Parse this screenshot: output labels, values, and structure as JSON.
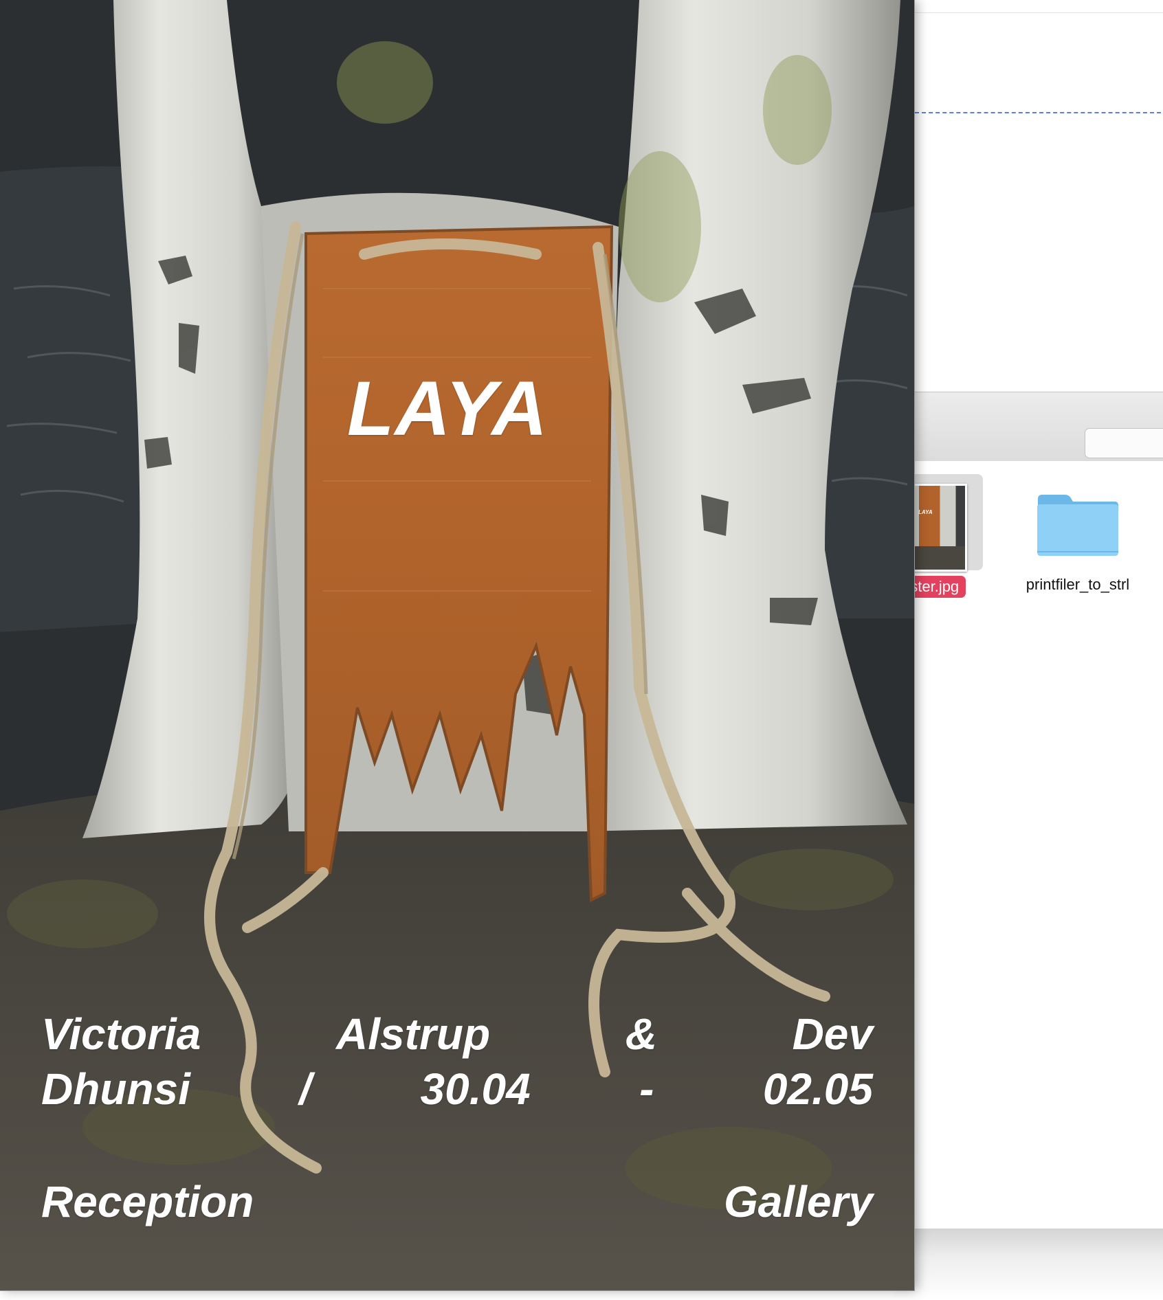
{
  "poster": {
    "title": "LAYA",
    "line1": [
      "Victoria",
      "Alstrup",
      "&",
      "Dev"
    ],
    "line2": [
      "Dhunsi",
      "/",
      "30.04",
      "-",
      "02.05"
    ],
    "line3": [
      "Reception",
      "Gallery"
    ]
  },
  "finder": {
    "files": [
      {
        "name": "poster.jpg",
        "visible_label": "oster.jpg",
        "selected": true,
        "type": "image"
      },
      {
        "name": "printfiler_to_strl",
        "visible_label": "printfiler_to_strl",
        "selected": false,
        "type": "folder"
      }
    ],
    "thumbnail_title": "LAYA"
  },
  "colors": {
    "selection_label": "#e4415f",
    "folder_blue": "#7cc6f2",
    "poster_text": "#ffffff",
    "rust_panel": "#b2622b",
    "dashed_line": "#5b7fe0"
  },
  "icons": [
    "folder-icon",
    "image-thumbnail"
  ]
}
